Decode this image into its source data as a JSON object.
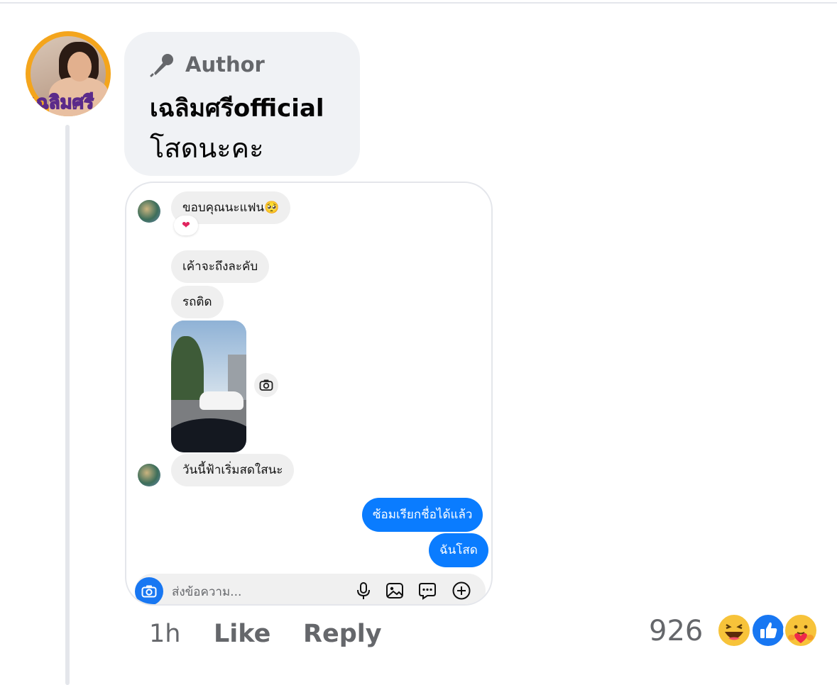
{
  "comment": {
    "author_badge": "Author",
    "name": "เฉลิมศรีofficial",
    "text": "โสดนะคะ",
    "avatar_logo_text": "เฉลิมศรี"
  },
  "chat": {
    "messages_in": [
      "ขอบคุณนะแฟน🥺",
      "เค้าจะถึงละคับ",
      "รถติด",
      "วันนี้ฟ้าเริ่มสดใสนะ"
    ],
    "reaction": "❤",
    "messages_out": [
      "ซ้อมเรียกชื่อได้แล้ว",
      "ฉันโสด"
    ],
    "composer_placeholder": "ส่งข้อความ..."
  },
  "actions": {
    "time": "1h",
    "like": "Like",
    "reply": "Reply"
  },
  "reactions": {
    "count": "926",
    "icons": [
      "haha-icon",
      "like-icon",
      "care-icon"
    ]
  },
  "colors": {
    "bubble_bg": "#f0f2f5",
    "outgoing_blue": "#0a7cff",
    "muted_text": "#65676b",
    "like_blue": "#1877f2"
  }
}
